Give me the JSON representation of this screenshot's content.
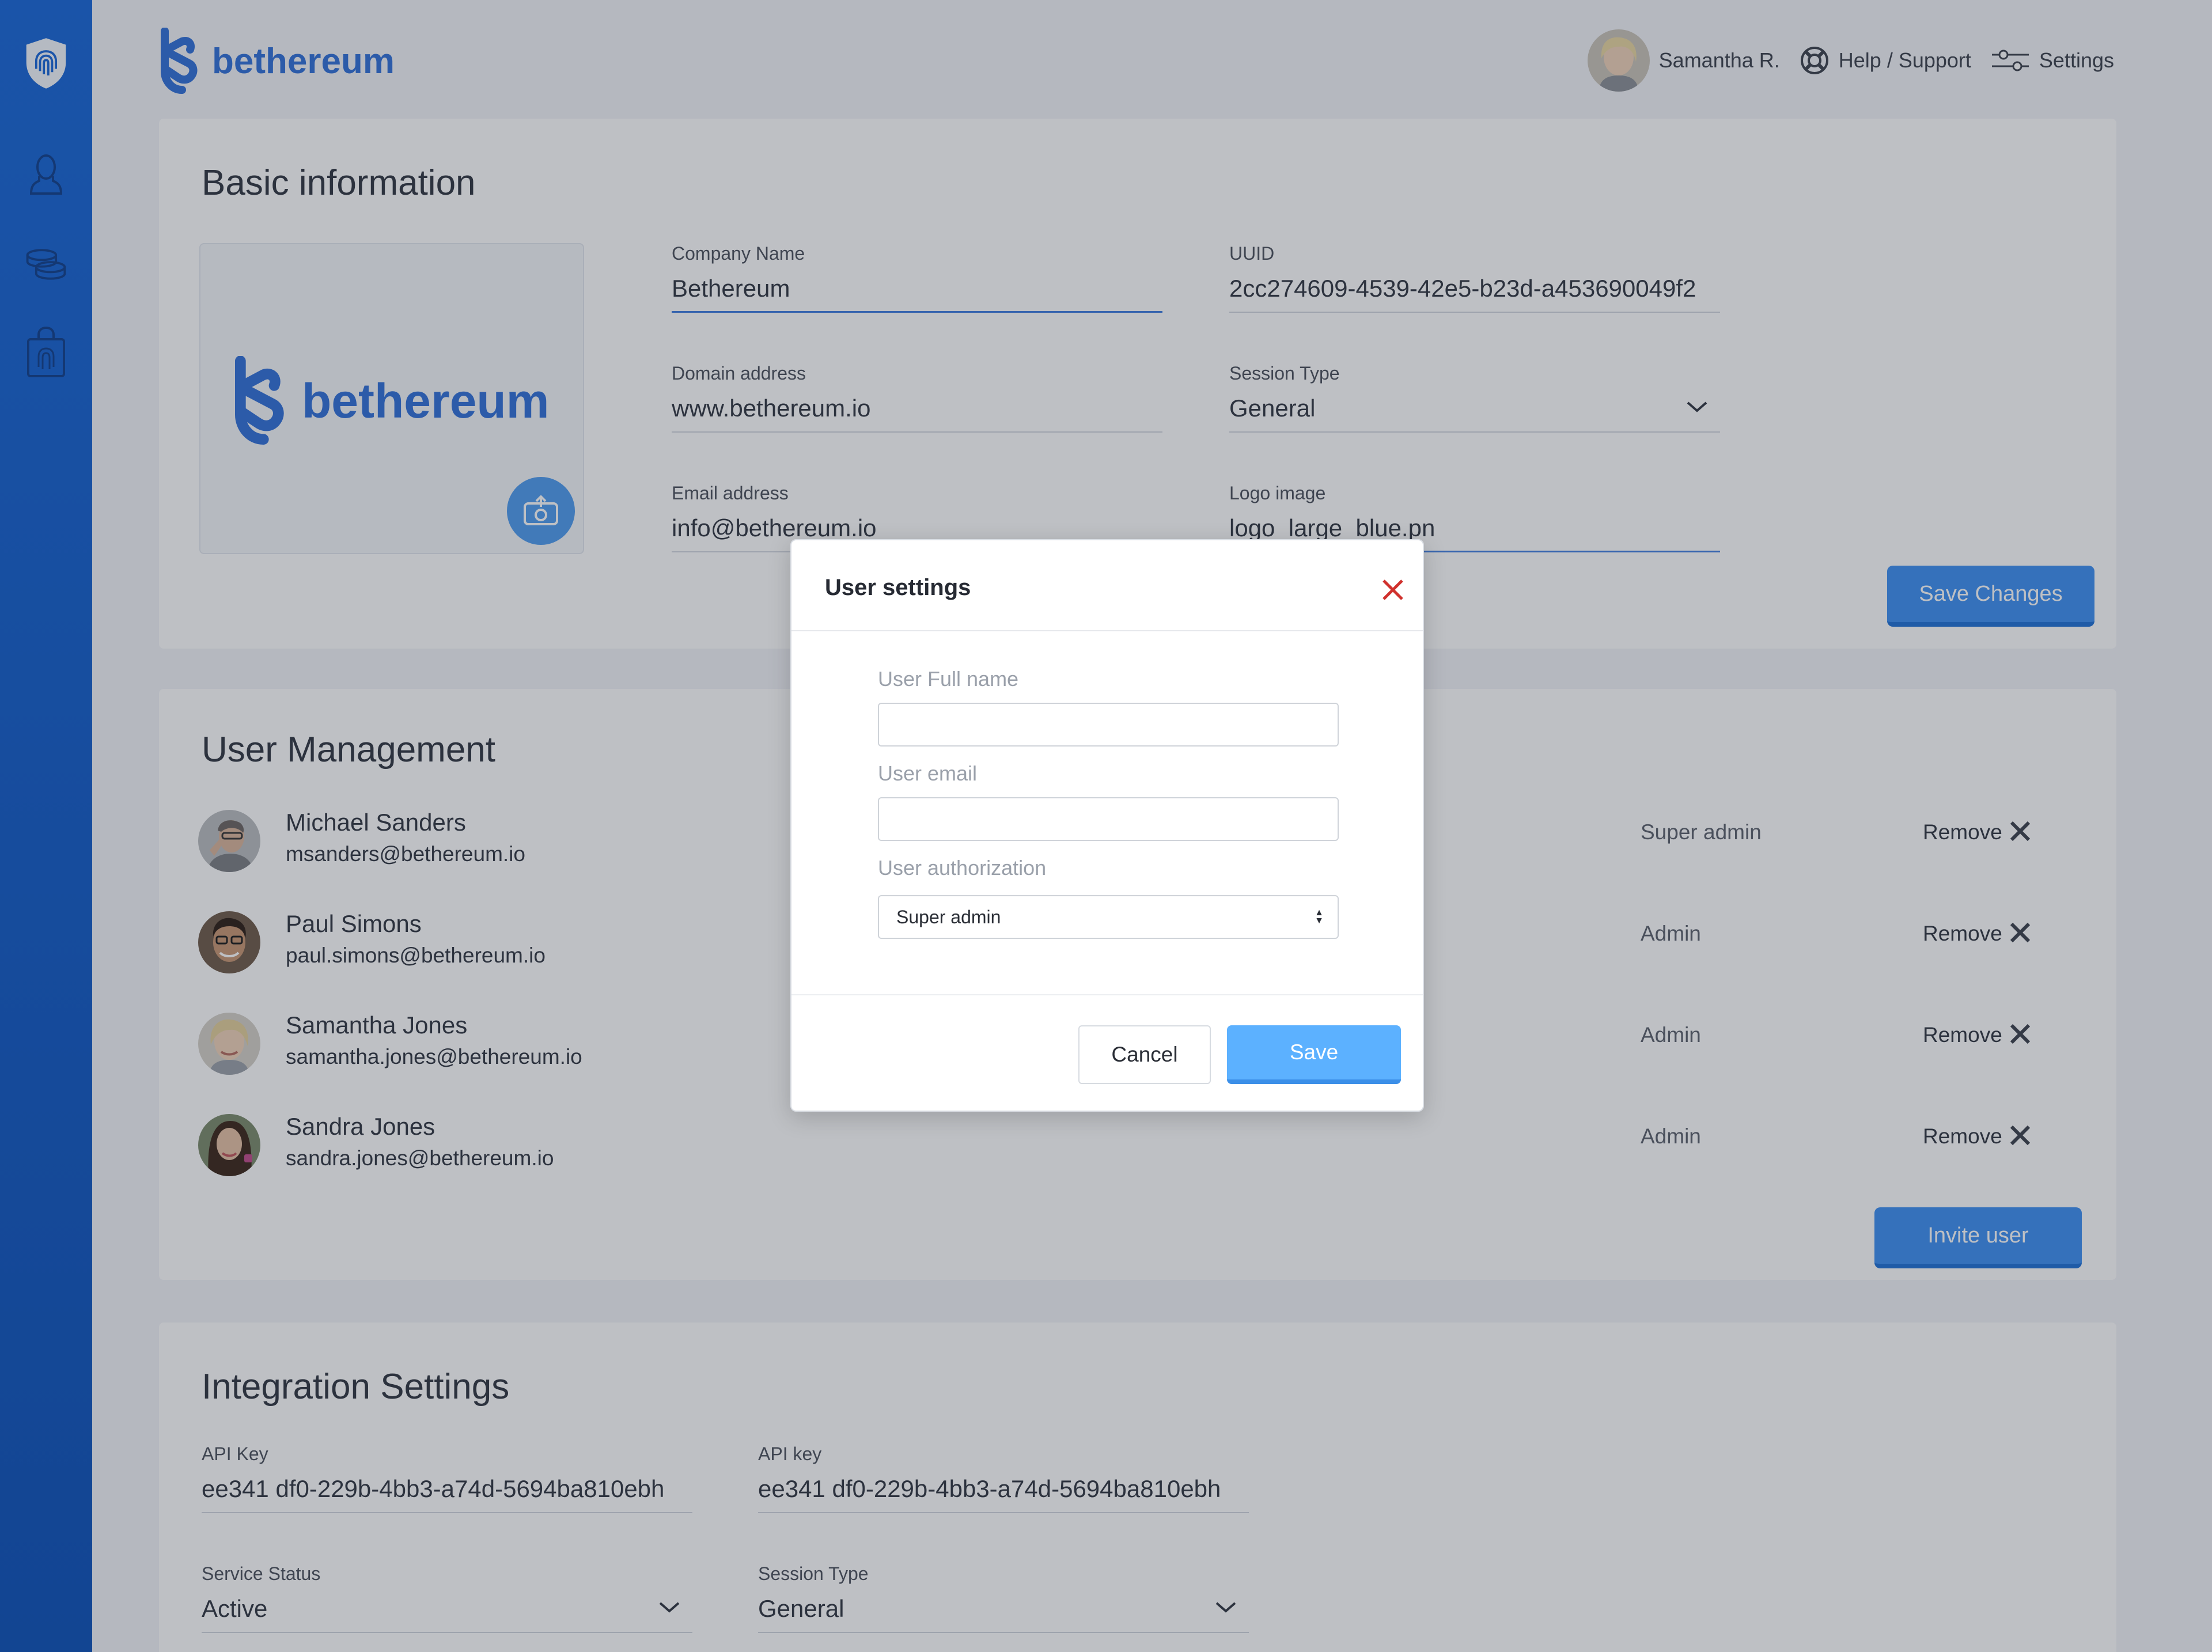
{
  "app": {
    "brand": "bethereum"
  },
  "topbar": {
    "user_name": "Samantha R.",
    "help_label": "Help / Support",
    "settings_label": "Settings"
  },
  "sidebar": {
    "items": [
      {
        "icon": "fingerprint-shield-icon"
      },
      {
        "icon": "user-icon"
      },
      {
        "icon": "coins-icon"
      },
      {
        "icon": "shopping-bag-fingerprint-icon"
      }
    ]
  },
  "basic_info": {
    "title": "Basic information",
    "logo_text": "bethereum",
    "company_name": {
      "label": "Company Name",
      "value": "Bethereum"
    },
    "uuid": {
      "label": "UUID",
      "value": "2cc274609-4539-42e5-b23d-a453690049f2"
    },
    "domain": {
      "label": "Domain address",
      "value": "www.bethereum.io"
    },
    "session_type": {
      "label": "Session Type",
      "value": "General"
    },
    "email": {
      "label": "Email address",
      "value": "info@bethereum.io"
    },
    "logo_image": {
      "label": "Logo image",
      "value": "logo_large_blue.pn"
    },
    "save_button": "Save Changes"
  },
  "user_management": {
    "title": "User Management",
    "remove_label": "Remove",
    "users": [
      {
        "name": "Michael Sanders",
        "email": "msanders@bethereum.io",
        "role": "Super admin"
      },
      {
        "name": "Paul Simons",
        "email": "paul.simons@bethereum.io",
        "role": "Admin"
      },
      {
        "name": "Samantha Jones",
        "email": "samantha.jones@bethereum.io",
        "role": "Admin"
      },
      {
        "name": "Sandra Jones",
        "email": "sandra.jones@bethereum.io",
        "role": "Admin"
      }
    ],
    "invite_button": "Invite user"
  },
  "integration": {
    "title": "Integration Settings",
    "api_key_1": {
      "label": "API Key",
      "value": "ee341 df0-229b-4bb3-a74d-5694ba810ebh"
    },
    "api_key_2": {
      "label": "API key",
      "value": "ee341 df0-229b-4bb3-a74d-5694ba810ebh"
    },
    "service_status": {
      "label": "Service Status",
      "value": "Active"
    },
    "session_type": {
      "label": "Session Type",
      "value": "General"
    }
  },
  "modal": {
    "title": "User settings",
    "full_name_label": "User Full name",
    "full_name_value": "",
    "email_label": "User email",
    "email_value": "",
    "authorization_label": "User authorization",
    "authorization_value": "Super admin",
    "cancel_label": "Cancel",
    "save_label": "Save"
  },
  "colors": {
    "sidebar": "#1565d8",
    "primary": "#3b8ef2",
    "modal_save": "#5cb1ff",
    "close_red": "#d0312d"
  }
}
